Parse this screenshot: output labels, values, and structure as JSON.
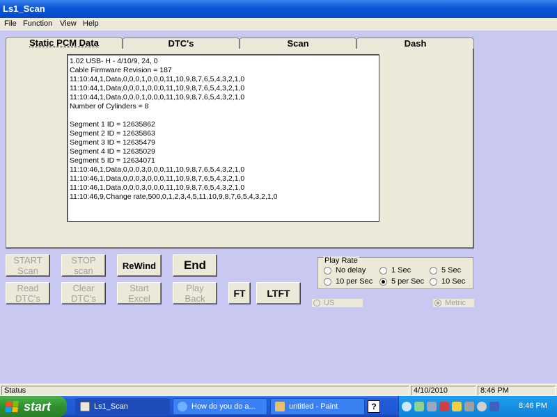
{
  "window": {
    "title": "Ls1_Scan"
  },
  "menu": {
    "items": [
      "File",
      "Function",
      "View",
      "Help"
    ]
  },
  "tabs": [
    "Static PCM Data",
    "DTC's",
    "Scan",
    "Dash"
  ],
  "log_lines": [
    "1.02 USB- H - 4/10/9, 24, 0",
    "Cable Firmware Revision = 187",
    "11:10:44,1,Data,0,0,0,1,0,0,0,11,10,9,8,7,6,5,4,3,2,1,0",
    "11:10:44,1,Data,0,0,0,1,0,0,0,11,10,9,8,7,6,5,4,3,2,1,0",
    "11:10:44,1,Data,0,0,0,1,0,0,0,11,10,9,8,7,6,5,4,3,2,1,0",
    "Number of Cylinders = 8",
    "",
    "Segment 1 ID = 12635862",
    "Segment 2 ID = 12635863",
    "Segment 3 ID = 12635479",
    "Segment 4 ID = 12635029",
    "Segment 5 ID = 12634071",
    "11:10:46,1,Data,0,0,0,3,0,0,0,11,10,9,8,7,6,5,4,3,2,1,0",
    "11:10:46,1,Data,0,0,0,3,0,0,0,11,10,9,8,7,6,5,4,3,2,1,0",
    "11:10:46,1,Data,0,0,0,3,0,0,0,11,10,9,8,7,6,5,4,3,2,1,0",
    "11:10:46,9,Change rate,500,0,1,2,3,4,5,11,10,9,8,7,6,5,4,3,2,1,0"
  ],
  "buttons": {
    "start_scan": {
      "l1": "START",
      "l2": "Scan"
    },
    "stop_scan": {
      "l1": "STOP",
      "l2": "scan"
    },
    "rewind": "ReWind",
    "end": "End",
    "read_dtcs": {
      "l1": "Read",
      "l2": "DTC's"
    },
    "clear_dtcs": {
      "l1": "Clear",
      "l2": "DTC's"
    },
    "start_excel": {
      "l1": "Start",
      "l2": "Excel"
    },
    "play_back": {
      "l1": "Play",
      "l2": "Back"
    },
    "ft": "FT",
    "ltft": "LTFT"
  },
  "play_rate": {
    "label": "Play Rate",
    "options": [
      "No delay",
      "1 Sec",
      "5 Sec",
      "10 per Sec",
      "5 per Sec",
      "10 Sec"
    ],
    "selected": "5 per Sec"
  },
  "units": {
    "us": "US",
    "metric": "Metric",
    "selected": "Metric"
  },
  "status": {
    "text": "Status",
    "date": "4/10/2010",
    "time": "8:46 PM"
  },
  "taskbar": {
    "start": "start",
    "tasks": [
      "Ls1_Scan",
      "How do you do a...",
      "untitled - Paint"
    ],
    "clock": "8:46 PM"
  }
}
